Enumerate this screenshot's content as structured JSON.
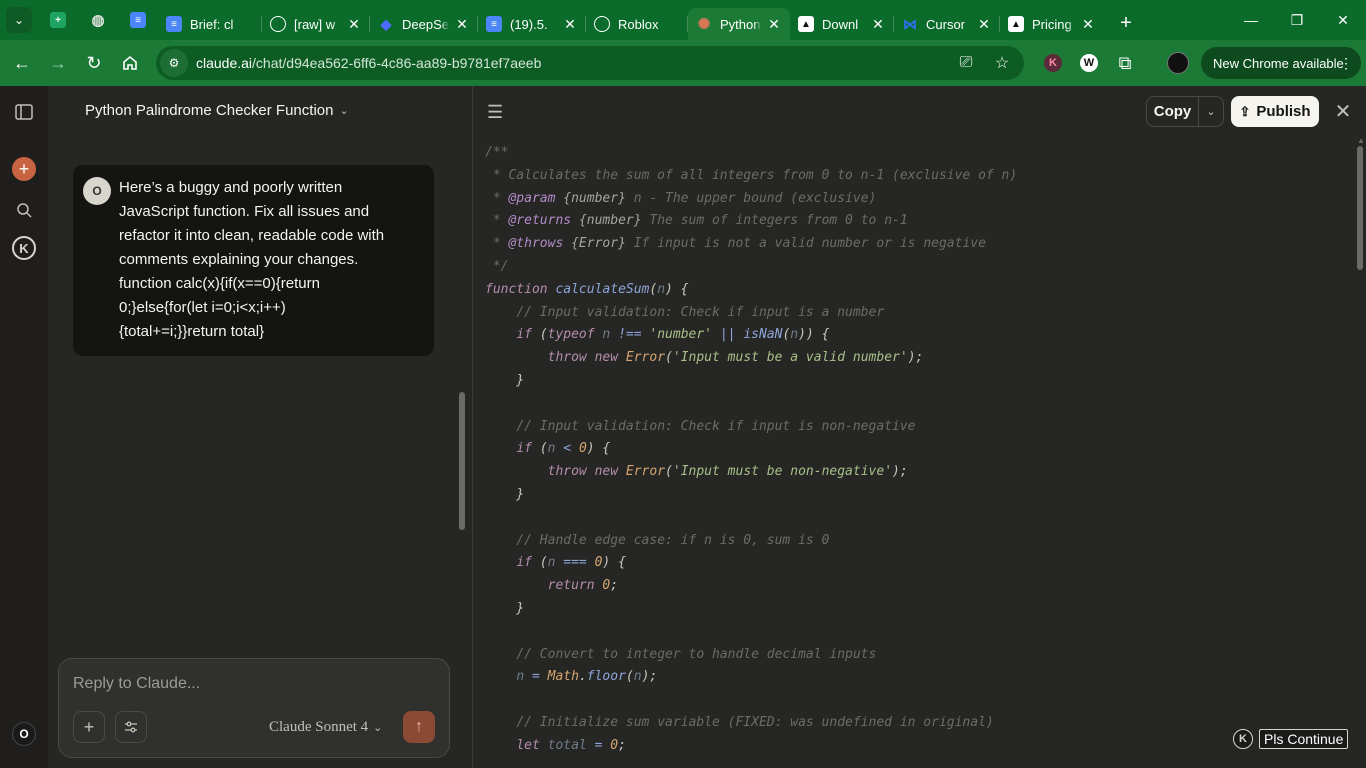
{
  "browser": {
    "tabs": [
      {
        "label": "Brief: cl",
        "icon": "google-docs-icon",
        "color": "#4a86f7"
      },
      {
        "label": "[raw] w",
        "icon": "openai-icon",
        "color": "#ffffff"
      },
      {
        "label": "DeepSe",
        "icon": "deepseek-icon",
        "color": "#4d6bfe"
      },
      {
        "label": "(19).5.",
        "icon": "google-docs-icon",
        "color": "#4a86f7"
      },
      {
        "label": "Roblox",
        "icon": "openai-icon",
        "color": "#ffffff"
      },
      {
        "label": "Python",
        "icon": "claude-icon",
        "color": "#d97757",
        "active": true
      },
      {
        "label": "Downl",
        "icon": "cursor-icon",
        "color": "#ffffff"
      },
      {
        "label": "Cursor",
        "icon": "meta-icon",
        "color": "#2b73f0"
      },
      {
        "label": "Pricing",
        "icon": "cursor-icon",
        "color": "#ffffff"
      }
    ],
    "url_host": "claude.ai",
    "url_path": "/chat/d94ea562-6ff6-4c86-aa89-b9781ef7aeeb",
    "update_label": "New Chrome available"
  },
  "chat": {
    "title": "Python Palindrome Checker Function",
    "user_initial": "O",
    "message": "Here’s a buggy and poorly written\nJavaScript function. Fix all issues and\nrefactor it into clean, readable code with\ncomments explaining your changes.\nfunction calc(x){if(x==0){return\n0;}else{for(let i=0;i<x;i++)\n{total+=i;}}return total}",
    "composer_placeholder": "Reply to Claude...",
    "model": "Claude Sonnet 4"
  },
  "artifact": {
    "copy_label": "Copy",
    "publish_label": "Publish",
    "code_lines": [
      "/**",
      " * Calculates the sum of all integers from 0 to n-1 (exclusive of n)",
      " * @param {number} n - The upper bound (exclusive)",
      " * @returns {number} The sum of integers from 0 to n-1",
      " * @throws {Error} If input is not a valid number or is negative",
      " */",
      "function calculateSum(n) {",
      "    // Input validation: Check if input is a number",
      "    if (typeof n !== 'number' || isNaN(n)) {",
      "        throw new Error('Input must be a valid number');",
      "    }",
      "",
      "    // Input validation: Check if input is non-negative",
      "    if (n < 0) {",
      "        throw new Error('Input must be non-negative');",
      "    }",
      "",
      "    // Handle edge case: if n is 0, sum is 0",
      "    if (n === 0) {",
      "        return 0;",
      "    }",
      "",
      "    // Convert to integer to handle decimal inputs",
      "    n = Math.floor(n);",
      "",
      "    // Initialize sum variable (FIXED: was undefined in original)",
      "    let total = 0;"
    ]
  },
  "extension": {
    "label": "Pls Continue",
    "logo": "K"
  },
  "rail": {
    "user_initial": "O"
  }
}
